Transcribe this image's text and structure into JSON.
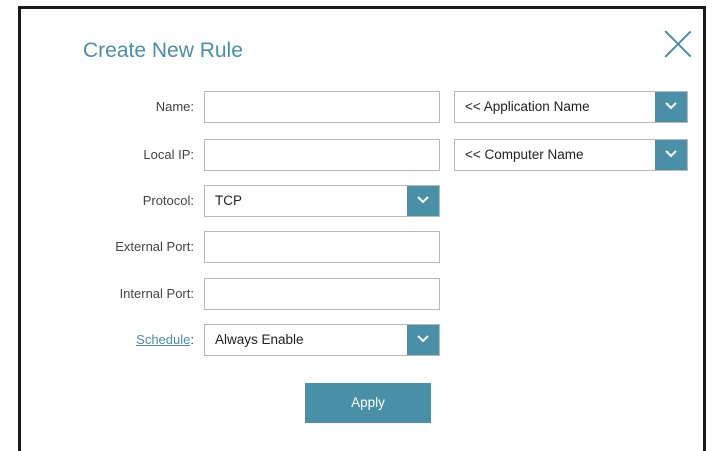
{
  "dialog": {
    "title": "Create New Rule"
  },
  "form": {
    "name_label": "Name:",
    "name_value": "",
    "app_name_select": "<< Application Name",
    "local_ip_label": "Local IP:",
    "local_ip_value": "",
    "computer_name_select": "<< Computer Name",
    "protocol_label": "Protocol:",
    "protocol_value": "TCP",
    "external_port_label": "External Port:",
    "external_port_value": "",
    "internal_port_label": "Internal Port:",
    "internal_port_value": "",
    "schedule_label": "Schedule",
    "schedule_colon": ":",
    "schedule_value": "Always Enable"
  },
  "actions": {
    "apply_label": "Apply"
  },
  "colors": {
    "accent": "#4a8fa8",
    "label_text": "#444444",
    "border": "#b8b8b8"
  },
  "icons": {
    "close": "close-icon",
    "dropdown": "chevron-down-icon"
  }
}
